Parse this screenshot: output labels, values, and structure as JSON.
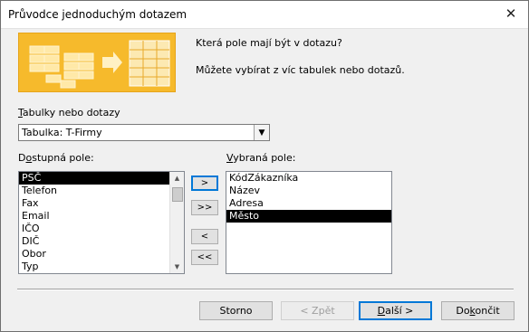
{
  "window": {
    "title": "Průvodce jednoduchým dotazem",
    "close_glyph": "✕"
  },
  "header": {
    "question": "Která pole mají být v dotazu?",
    "hint": "Můžete vybírat z víc tabulek nebo dotazů."
  },
  "tables": {
    "label_accel": "T",
    "label_rest": "abulky nebo dotazy",
    "selected": "Tabulka: T-Firmy"
  },
  "available": {
    "label_pre": "D",
    "label_accel": "o",
    "label_rest": "stupná pole:",
    "items": [
      "PSČ",
      "Telefon",
      "Fax",
      "Email",
      "IČO",
      "DIČ",
      "Obor",
      "Typ"
    ],
    "selected_index": 0
  },
  "chosen": {
    "label_accel": "V",
    "label_rest": "ybraná pole:",
    "items": [
      "KódZákazníka",
      "Název",
      "Adresa",
      "Město"
    ],
    "selected_index": 3
  },
  "move_buttons": {
    "add_one": ">",
    "add_all": ">>",
    "remove_one": "<",
    "remove_all": "<<"
  },
  "buttons": {
    "cancel": "Storno",
    "back": "< Zpět",
    "next_accel": "D",
    "next_rest": "alší >",
    "finish_pre": "Do",
    "finish_accel": "k",
    "finish_rest": "ončit"
  },
  "colors": {
    "selection": "#000000",
    "wizard_orange": "#f6ba2c",
    "focus_border": "#0078d7"
  }
}
